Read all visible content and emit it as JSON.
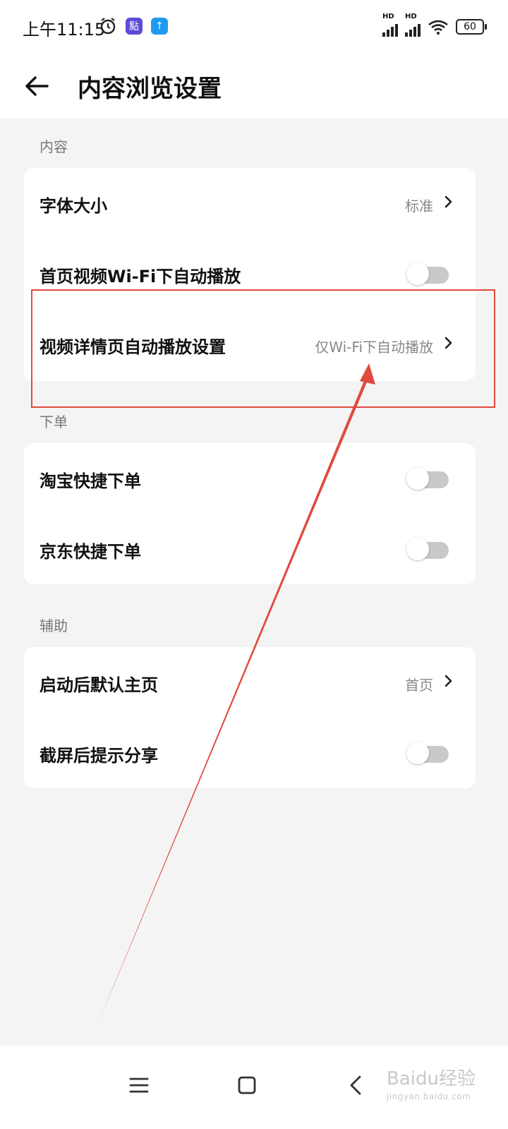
{
  "status": {
    "time": "上午11:15",
    "battery": "60",
    "hd": "HD",
    "app_badge_1": "點",
    "app_badge_2": "↑"
  },
  "header": {
    "title": "内容浏览设置"
  },
  "sections": [
    {
      "label": "内容",
      "rows": [
        {
          "label": "字体大小",
          "value": "标准",
          "type": "link"
        },
        {
          "label": "首页视频Wi-Fi下自动播放",
          "type": "toggle",
          "on": false
        },
        {
          "label": "视频详情页自动播放设置",
          "value": "仅Wi-Fi下自动播放",
          "type": "link"
        }
      ]
    },
    {
      "label": "下单",
      "rows": [
        {
          "label": "淘宝快捷下单",
          "type": "toggle",
          "on": false
        },
        {
          "label": "京东快捷下单",
          "type": "toggle",
          "on": false
        }
      ]
    },
    {
      "label": "辅助",
      "rows": [
        {
          "label": "启动后默认主页",
          "value": "首页",
          "type": "link"
        },
        {
          "label": "截屏后提示分享",
          "type": "toggle",
          "on": false
        }
      ]
    }
  ],
  "watermark": {
    "text": "Baidu经验",
    "sub": "jingyan.baidu.com"
  },
  "colors": {
    "annotation": "#e04a3f",
    "accent_badge_1": "#5b4bd8",
    "accent_badge_2": "#1e9bf0"
  }
}
